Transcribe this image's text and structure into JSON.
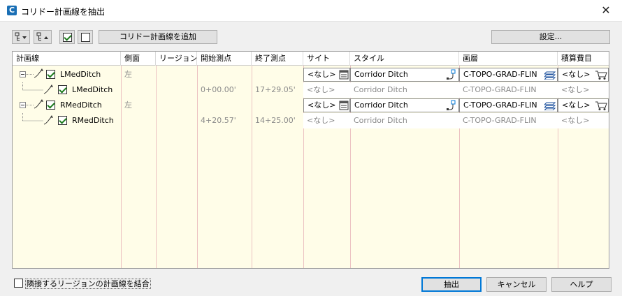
{
  "window": {
    "title": "コリドー計画線を抽出",
    "app_icon_letter": "C",
    "close_glyph": "✕"
  },
  "toolbar": {
    "add_label": "コリドー計画線を追加",
    "settings_label": "設定..."
  },
  "table": {
    "columns": [
      "計画線",
      "側面",
      "リージョン",
      "開始測点",
      "終了測点",
      "サイト",
      "スタイル",
      "画層",
      "積算費目"
    ],
    "rows": [
      {
        "level": 0,
        "checked": true,
        "name": "LMedDitch",
        "side": "左",
        "region": "",
        "start": "",
        "end": "",
        "site": "<なし>",
        "style": "Corridor Ditch",
        "layer": "C-TOPO-GRAD-FLIN",
        "pay_item": "<なし>",
        "editable": true
      },
      {
        "level": 1,
        "checked": true,
        "name": "LMedDitch",
        "side": "",
        "region": "",
        "start": "0+00.00'",
        "end": "17+29.05'",
        "site": "<なし>",
        "style": "Corridor Ditch",
        "layer": "C-TOPO-GRAD-FLIN",
        "pay_item": "<なし>",
        "editable": false
      },
      {
        "level": 0,
        "checked": true,
        "name": "RMedDitch",
        "side": "左",
        "region": "",
        "start": "",
        "end": "",
        "site": "<なし>",
        "style": "Corridor Ditch",
        "layer": "C-TOPO-GRAD-FLIN",
        "pay_item": "<なし>",
        "editable": true
      },
      {
        "level": 1,
        "checked": true,
        "name": "RMedDitch",
        "side": "",
        "region": "",
        "start": "4+20.57'",
        "end": "14+25.00'",
        "site": "<なし>",
        "style": "Corridor Ditch",
        "layer": "C-TOPO-GRAD-FLIN",
        "pay_item": "<なし>",
        "editable": false
      }
    ]
  },
  "footer": {
    "merge_label": "隣接するリージョンの計画線を結合",
    "merge_checked": false,
    "extract_label": "抽出",
    "cancel_label": "キャンセル",
    "help_label": "ヘルプ"
  },
  "colors": {
    "grid_bg": "#fffde8",
    "accent": "#0078d7",
    "column_line": "#ecc2c2"
  }
}
